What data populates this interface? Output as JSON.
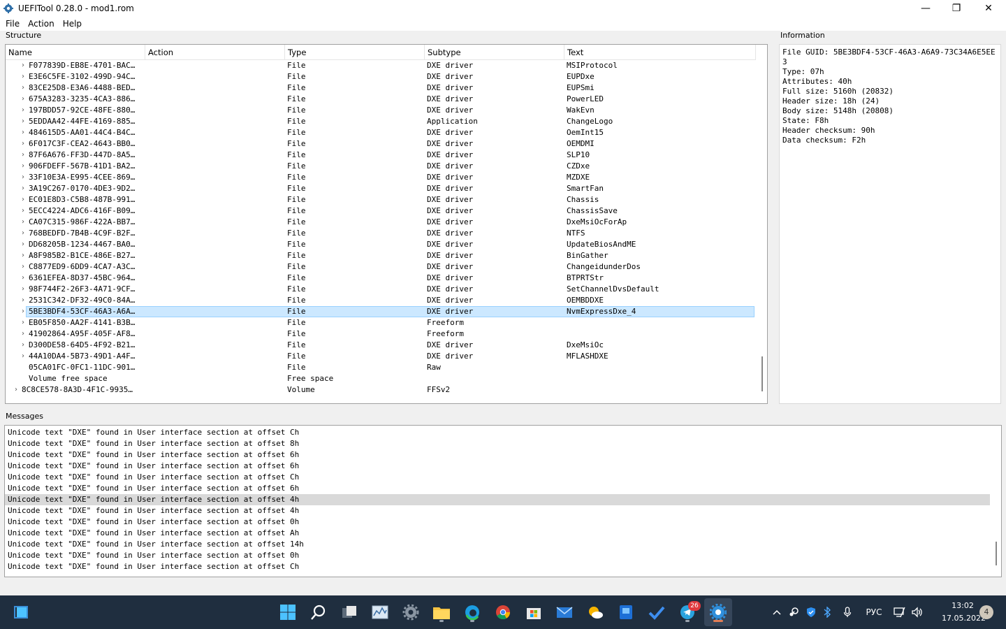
{
  "window": {
    "title": "UEFITool 0.28.0 - mod1.rom",
    "minimize": "—",
    "maximize": "❐",
    "close": "✕"
  },
  "menu": {
    "file": "File",
    "action": "Action",
    "help": "Help"
  },
  "structure": {
    "label": "Structure",
    "columns": {
      "name": "Name",
      "action": "Action",
      "type": "Type",
      "subtype": "Subtype",
      "text": "Text"
    },
    "rows": [
      {
        "name": "F077839D-EB8E-4701-BAC…",
        "type": "File",
        "subtype": "DXE driver",
        "text": "MSIProtocol"
      },
      {
        "name": "E3E6C5FE-3102-499D-94C…",
        "type": "File",
        "subtype": "DXE driver",
        "text": "EUPDxe"
      },
      {
        "name": "83CE25D8-E3A6-4488-BED…",
        "type": "File",
        "subtype": "DXE driver",
        "text": "EUPSmi"
      },
      {
        "name": "675A3283-3235-4CA3-886…",
        "type": "File",
        "subtype": "DXE driver",
        "text": "PowerLED"
      },
      {
        "name": "197BDD57-92CE-48FE-880…",
        "type": "File",
        "subtype": "DXE driver",
        "text": "WakEvn"
      },
      {
        "name": "5EDDAA42-44FE-4169-885…",
        "type": "File",
        "subtype": "Application",
        "text": "ChangeLogo"
      },
      {
        "name": "484615D5-AA01-44C4-B4C…",
        "type": "File",
        "subtype": "DXE driver",
        "text": "OemInt15"
      },
      {
        "name": "6F017C3F-CEA2-4643-BB0…",
        "type": "File",
        "subtype": "DXE driver",
        "text": "OEMDMI"
      },
      {
        "name": "87F6A676-FF3D-447D-8A5…",
        "type": "File",
        "subtype": "DXE driver",
        "text": "SLP10"
      },
      {
        "name": "906FDEFF-567B-41D1-BA2…",
        "type": "File",
        "subtype": "DXE driver",
        "text": "CZDxe"
      },
      {
        "name": "33F10E3A-E995-4CEE-869…",
        "type": "File",
        "subtype": "DXE driver",
        "text": "MZDXE"
      },
      {
        "name": "3A19C267-0170-4DE3-9D2…",
        "type": "File",
        "subtype": "DXE driver",
        "text": "SmartFan"
      },
      {
        "name": "EC01E8D3-C5B8-487B-991…",
        "type": "File",
        "subtype": "DXE driver",
        "text": "Chassis"
      },
      {
        "name": "5ECC4224-ADC6-416F-B09…",
        "type": "File",
        "subtype": "DXE driver",
        "text": "ChassisSave"
      },
      {
        "name": "CA07C315-986F-422A-BB7…",
        "type": "File",
        "subtype": "DXE driver",
        "text": "DxeMsiOcForAp"
      },
      {
        "name": "768BEDFD-7B4B-4C9F-B2F…",
        "type": "File",
        "subtype": "DXE driver",
        "text": "NTFS"
      },
      {
        "name": "DD68205B-1234-4467-BA0…",
        "type": "File",
        "subtype": "DXE driver",
        "text": "UpdateBiosAndME"
      },
      {
        "name": "A8F985B2-B1CE-486E-B27…",
        "type": "File",
        "subtype": "DXE driver",
        "text": "BinGather"
      },
      {
        "name": "C8877ED9-6DD9-4CA7-A3C…",
        "type": "File",
        "subtype": "DXE driver",
        "text": "ChangeidunderDos"
      },
      {
        "name": "6361EFEA-8D37-45BC-964…",
        "type": "File",
        "subtype": "DXE driver",
        "text": "BTPRTStr"
      },
      {
        "name": "98F744F2-26F3-4A71-9CF…",
        "type": "File",
        "subtype": "DXE driver",
        "text": "SetChannelDvsDefault"
      },
      {
        "name": "2531C342-DF32-49C0-84A…",
        "type": "File",
        "subtype": "DXE driver",
        "text": "OEMBDDXE"
      },
      {
        "name": "5BE3BDF4-53CF-46A3-A6A…",
        "type": "File",
        "subtype": "DXE driver",
        "text": "NvmExpressDxe_4"
      },
      {
        "name": "EB05F850-AA2F-4141-B3B…",
        "type": "File",
        "subtype": "Freeform",
        "text": ""
      },
      {
        "name": "41902864-A95F-405F-AF8…",
        "type": "File",
        "subtype": "Freeform",
        "text": ""
      },
      {
        "name": "D300DE58-64D5-4F92-B21…",
        "type": "File",
        "subtype": "DXE driver",
        "text": "DxeMsiOc"
      },
      {
        "name": "44A10DA4-5B73-49D1-A4F…",
        "type": "File",
        "subtype": "DXE driver",
        "text": "MFLASHDXE"
      },
      {
        "name": "05CA01FC-0FC1-11DC-901…",
        "type": "File",
        "subtype": "Raw",
        "text": ""
      },
      {
        "name": "Volume free space",
        "type": "Free space",
        "subtype": "",
        "text": ""
      },
      {
        "name": "8C8CE578-8A3D-4F1C-9935…",
        "type": "Volume",
        "subtype": "FFSv2",
        "text": ""
      }
    ]
  },
  "information": {
    "label": "Information",
    "lines": [
      "File GUID: 5BE3BDF4-53CF-46A3-A6A9-73C34A6E5EE3",
      "Type: 07h",
      "Attributes: 40h",
      "Full size: 5160h (20832)",
      "Header size: 18h (24)",
      "Body size: 5148h (20808)",
      "State: F8h",
      "Header checksum: 90h",
      "Data checksum: F2h"
    ]
  },
  "messages": {
    "label": "Messages",
    "rows": [
      "Unicode text \"DXE\" found in User interface section at offset Ch",
      "Unicode text \"DXE\" found in User interface section at offset 8h",
      "Unicode text \"DXE\" found in User interface section at offset 6h",
      "Unicode text \"DXE\" found in User interface section at offset 6h",
      "Unicode text \"DXE\" found in User interface section at offset Ch",
      "Unicode text \"DXE\" found in User interface section at offset 6h",
      "Unicode text \"DXE\" found in User interface section at offset 4h",
      "Unicode text \"DXE\" found in User interface section at offset 4h",
      "Unicode text \"DXE\" found in User interface section at offset 0h",
      "Unicode text \"DXE\" found in User interface section at offset Ah",
      "Unicode text \"DXE\" found in User interface section at offset 14h",
      "Unicode text \"DXE\" found in User interface section at offset 0h",
      "Unicode text \"DXE\" found in User interface section at offset Ch"
    ]
  },
  "taskbar": {
    "language": "РУС",
    "time": "13:02",
    "date": "17.05.2022",
    "notifications": "4",
    "telegram_badge": "26"
  }
}
